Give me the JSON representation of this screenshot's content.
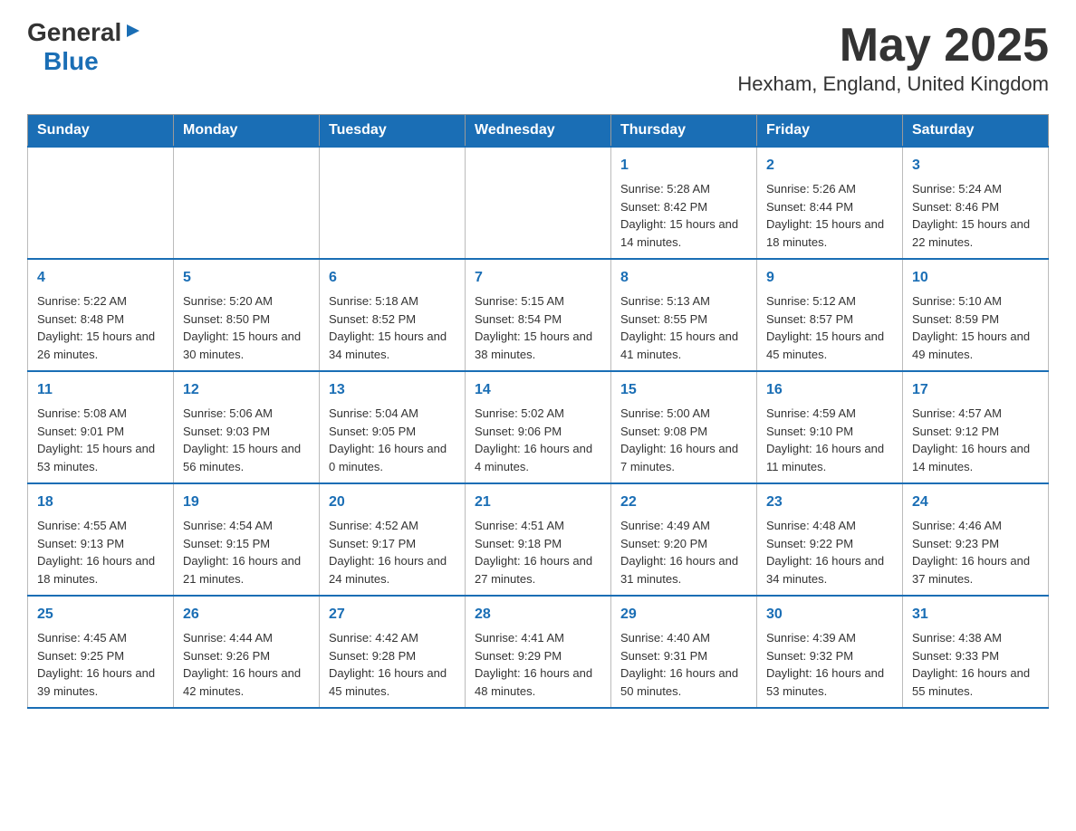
{
  "header": {
    "logo_general": "General",
    "logo_blue": "Blue",
    "title": "May 2025",
    "subtitle": "Hexham, England, United Kingdom"
  },
  "weekdays": [
    "Sunday",
    "Monday",
    "Tuesday",
    "Wednesday",
    "Thursday",
    "Friday",
    "Saturday"
  ],
  "weeks": [
    [
      {
        "day": "",
        "sunrise": "",
        "sunset": "",
        "daylight": ""
      },
      {
        "day": "",
        "sunrise": "",
        "sunset": "",
        "daylight": ""
      },
      {
        "day": "",
        "sunrise": "",
        "sunset": "",
        "daylight": ""
      },
      {
        "day": "",
        "sunrise": "",
        "sunset": "",
        "daylight": ""
      },
      {
        "day": "1",
        "sunrise": "Sunrise: 5:28 AM",
        "sunset": "Sunset: 8:42 PM",
        "daylight": "Daylight: 15 hours and 14 minutes."
      },
      {
        "day": "2",
        "sunrise": "Sunrise: 5:26 AM",
        "sunset": "Sunset: 8:44 PM",
        "daylight": "Daylight: 15 hours and 18 minutes."
      },
      {
        "day": "3",
        "sunrise": "Sunrise: 5:24 AM",
        "sunset": "Sunset: 8:46 PM",
        "daylight": "Daylight: 15 hours and 22 minutes."
      }
    ],
    [
      {
        "day": "4",
        "sunrise": "Sunrise: 5:22 AM",
        "sunset": "Sunset: 8:48 PM",
        "daylight": "Daylight: 15 hours and 26 minutes."
      },
      {
        "day": "5",
        "sunrise": "Sunrise: 5:20 AM",
        "sunset": "Sunset: 8:50 PM",
        "daylight": "Daylight: 15 hours and 30 minutes."
      },
      {
        "day": "6",
        "sunrise": "Sunrise: 5:18 AM",
        "sunset": "Sunset: 8:52 PM",
        "daylight": "Daylight: 15 hours and 34 minutes."
      },
      {
        "day": "7",
        "sunrise": "Sunrise: 5:15 AM",
        "sunset": "Sunset: 8:54 PM",
        "daylight": "Daylight: 15 hours and 38 minutes."
      },
      {
        "day": "8",
        "sunrise": "Sunrise: 5:13 AM",
        "sunset": "Sunset: 8:55 PM",
        "daylight": "Daylight: 15 hours and 41 minutes."
      },
      {
        "day": "9",
        "sunrise": "Sunrise: 5:12 AM",
        "sunset": "Sunset: 8:57 PM",
        "daylight": "Daylight: 15 hours and 45 minutes."
      },
      {
        "day": "10",
        "sunrise": "Sunrise: 5:10 AM",
        "sunset": "Sunset: 8:59 PM",
        "daylight": "Daylight: 15 hours and 49 minutes."
      }
    ],
    [
      {
        "day": "11",
        "sunrise": "Sunrise: 5:08 AM",
        "sunset": "Sunset: 9:01 PM",
        "daylight": "Daylight: 15 hours and 53 minutes."
      },
      {
        "day": "12",
        "sunrise": "Sunrise: 5:06 AM",
        "sunset": "Sunset: 9:03 PM",
        "daylight": "Daylight: 15 hours and 56 minutes."
      },
      {
        "day": "13",
        "sunrise": "Sunrise: 5:04 AM",
        "sunset": "Sunset: 9:05 PM",
        "daylight": "Daylight: 16 hours and 0 minutes."
      },
      {
        "day": "14",
        "sunrise": "Sunrise: 5:02 AM",
        "sunset": "Sunset: 9:06 PM",
        "daylight": "Daylight: 16 hours and 4 minutes."
      },
      {
        "day": "15",
        "sunrise": "Sunrise: 5:00 AM",
        "sunset": "Sunset: 9:08 PM",
        "daylight": "Daylight: 16 hours and 7 minutes."
      },
      {
        "day": "16",
        "sunrise": "Sunrise: 4:59 AM",
        "sunset": "Sunset: 9:10 PM",
        "daylight": "Daylight: 16 hours and 11 minutes."
      },
      {
        "day": "17",
        "sunrise": "Sunrise: 4:57 AM",
        "sunset": "Sunset: 9:12 PM",
        "daylight": "Daylight: 16 hours and 14 minutes."
      }
    ],
    [
      {
        "day": "18",
        "sunrise": "Sunrise: 4:55 AM",
        "sunset": "Sunset: 9:13 PM",
        "daylight": "Daylight: 16 hours and 18 minutes."
      },
      {
        "day": "19",
        "sunrise": "Sunrise: 4:54 AM",
        "sunset": "Sunset: 9:15 PM",
        "daylight": "Daylight: 16 hours and 21 minutes."
      },
      {
        "day": "20",
        "sunrise": "Sunrise: 4:52 AM",
        "sunset": "Sunset: 9:17 PM",
        "daylight": "Daylight: 16 hours and 24 minutes."
      },
      {
        "day": "21",
        "sunrise": "Sunrise: 4:51 AM",
        "sunset": "Sunset: 9:18 PM",
        "daylight": "Daylight: 16 hours and 27 minutes."
      },
      {
        "day": "22",
        "sunrise": "Sunrise: 4:49 AM",
        "sunset": "Sunset: 9:20 PM",
        "daylight": "Daylight: 16 hours and 31 minutes."
      },
      {
        "day": "23",
        "sunrise": "Sunrise: 4:48 AM",
        "sunset": "Sunset: 9:22 PM",
        "daylight": "Daylight: 16 hours and 34 minutes."
      },
      {
        "day": "24",
        "sunrise": "Sunrise: 4:46 AM",
        "sunset": "Sunset: 9:23 PM",
        "daylight": "Daylight: 16 hours and 37 minutes."
      }
    ],
    [
      {
        "day": "25",
        "sunrise": "Sunrise: 4:45 AM",
        "sunset": "Sunset: 9:25 PM",
        "daylight": "Daylight: 16 hours and 39 minutes."
      },
      {
        "day": "26",
        "sunrise": "Sunrise: 4:44 AM",
        "sunset": "Sunset: 9:26 PM",
        "daylight": "Daylight: 16 hours and 42 minutes."
      },
      {
        "day": "27",
        "sunrise": "Sunrise: 4:42 AM",
        "sunset": "Sunset: 9:28 PM",
        "daylight": "Daylight: 16 hours and 45 minutes."
      },
      {
        "day": "28",
        "sunrise": "Sunrise: 4:41 AM",
        "sunset": "Sunset: 9:29 PM",
        "daylight": "Daylight: 16 hours and 48 minutes."
      },
      {
        "day": "29",
        "sunrise": "Sunrise: 4:40 AM",
        "sunset": "Sunset: 9:31 PM",
        "daylight": "Daylight: 16 hours and 50 minutes."
      },
      {
        "day": "30",
        "sunrise": "Sunrise: 4:39 AM",
        "sunset": "Sunset: 9:32 PM",
        "daylight": "Daylight: 16 hours and 53 minutes."
      },
      {
        "day": "31",
        "sunrise": "Sunrise: 4:38 AM",
        "sunset": "Sunset: 9:33 PM",
        "daylight": "Daylight: 16 hours and 55 minutes."
      }
    ]
  ]
}
